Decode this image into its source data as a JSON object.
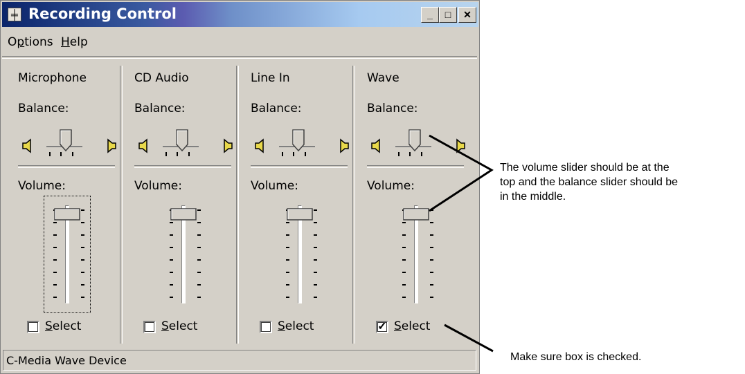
{
  "window": {
    "title": "Recording Control",
    "buttons": {
      "minimize": "_",
      "maximize": "□",
      "close": "✕"
    }
  },
  "menu": {
    "options": {
      "pre": "O",
      "ul": "p",
      "post": "tions"
    },
    "help": {
      "pre": "",
      "ul": "H",
      "post": "elp"
    }
  },
  "channels": [
    {
      "name": "Microphone",
      "balance_label": "Balance:",
      "volume_label": "Volume:",
      "select_label": {
        "ul": "S",
        "rest": "elect"
      },
      "selected": false,
      "volume_level": 1.0,
      "balance": 0.0,
      "focused": true
    },
    {
      "name": "CD Audio",
      "balance_label": "Balance:",
      "volume_label": "Volume:",
      "select_label": {
        "ul": "S",
        "rest": "elect"
      },
      "selected": false,
      "volume_level": 1.0,
      "balance": 0.0,
      "focused": false
    },
    {
      "name": "Line In",
      "balance_label": "Balance:",
      "volume_label": "Volume:",
      "select_label": {
        "ul": "S",
        "rest": "elect"
      },
      "selected": false,
      "volume_level": 1.0,
      "balance": 0.0,
      "focused": false
    },
    {
      "name": "Wave",
      "balance_label": "Balance:",
      "volume_label": "Volume:",
      "select_label": {
        "ul": "S",
        "rest": "elect"
      },
      "selected": true,
      "volume_level": 1.0,
      "balance": 0.0,
      "focused": false
    }
  ],
  "status_bar": "C-Media Wave Device",
  "annotations": {
    "slider_note": [
      "The volume slider should be at the",
      "top and the balance slider should be",
      "in the middle."
    ],
    "checkbox_note": "Make sure box is checked."
  },
  "colors": {
    "face": "#d4d0c8",
    "title_start": "#0a246a",
    "title_end": "#b8d4ee",
    "speaker": "#e8d84a"
  },
  "icons": {
    "app": "mixer-icon",
    "speaker_left": "speaker-left-icon",
    "speaker_right": "speaker-right-icon"
  }
}
